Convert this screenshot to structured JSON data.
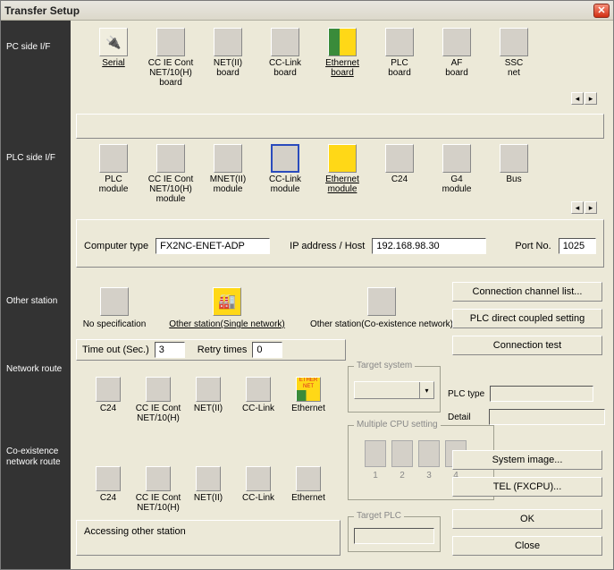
{
  "title": "Transfer Setup",
  "sidebar": {
    "pc_side": "PC side I/F",
    "plc_side": "PLC side I/F",
    "other_station": "Other station",
    "network_route": "Network route",
    "coexist_route": "Co-existence network route"
  },
  "pc_if": [
    {
      "label1": "Serial",
      "label2": "",
      "underline": true,
      "icon": "serial"
    },
    {
      "label1": "CC IE Cont",
      "label2": "NET/10(H)",
      "label3": "board"
    },
    {
      "label1": "NET(II)",
      "label2": "board"
    },
    {
      "label1": "CC-Link",
      "label2": "board"
    },
    {
      "label1": "Ethernet",
      "label2": "board",
      "underline": true,
      "icon": "eth",
      "selected": true
    },
    {
      "label1": "PLC",
      "label2": "board"
    },
    {
      "label1": "AF",
      "label2": "board"
    },
    {
      "label1": "SSC",
      "label2": "net"
    }
  ],
  "plc_if": [
    {
      "label1": "PLC",
      "label2": "module"
    },
    {
      "label1": "CC IE Cont",
      "label2": "NET/10(H)",
      "label3": "module"
    },
    {
      "label1": "MNET(II)",
      "label2": "module"
    },
    {
      "label1": "CC-Link",
      "label2": "module",
      "boxsel": true
    },
    {
      "label1": "Ethernet",
      "label2": "module",
      "underline": true,
      "icon": "yellow",
      "selected": true
    },
    {
      "label1": "C24",
      "label2": ""
    },
    {
      "label1": "G4",
      "label2": "module"
    },
    {
      "label1": "Bus",
      "label2": ""
    }
  ],
  "fields": {
    "computer_type_label": "Computer type",
    "computer_type": "FX2NC-ENET-ADP",
    "ip_label": "IP address / Host",
    "ip": "192.168.98.30",
    "port_label": "Port No.",
    "port": "1025",
    "timeout_label": "Time out (Sec.)",
    "timeout": "3",
    "retry_label": "Retry times",
    "retry": "0"
  },
  "other": [
    {
      "label": "No specification"
    },
    {
      "label": "Other station(Single network)",
      "underline": true,
      "sel": true
    },
    {
      "label": "Other station(Co-existence network)"
    }
  ],
  "route": [
    {
      "label": "C24"
    },
    {
      "label1": "CC IE Cont",
      "label2": "NET/10(H)"
    },
    {
      "label": "NET(II)"
    },
    {
      "label": "CC-Link"
    },
    {
      "label": "Ethernet",
      "sel": true,
      "tag": "ETHER NET"
    }
  ],
  "coexist": [
    {
      "label": "C24"
    },
    {
      "label1": "CC IE Cont",
      "label2": "NET/10(H)"
    },
    {
      "label": "NET(II)"
    },
    {
      "label": "CC-Link"
    },
    {
      "label": "Ethernet"
    }
  ],
  "buttons": {
    "conn_list": "Connection  channel  list...",
    "direct": "PLC direct coupled setting",
    "test": "Connection test",
    "sys_image": "System   image...",
    "tel": "TEL (FXCPU)...",
    "ok": "OK",
    "close": "Close"
  },
  "groups": {
    "target_system": "Target system",
    "multiple_cpu": "Multiple CPU setting",
    "target_plc": "Target PLC"
  },
  "info": {
    "plc_type_label": "PLC type",
    "detail_label": "Detail"
  },
  "cpu_nums": [
    "1",
    "2",
    "3",
    "4"
  ],
  "status": "Accessing other station"
}
